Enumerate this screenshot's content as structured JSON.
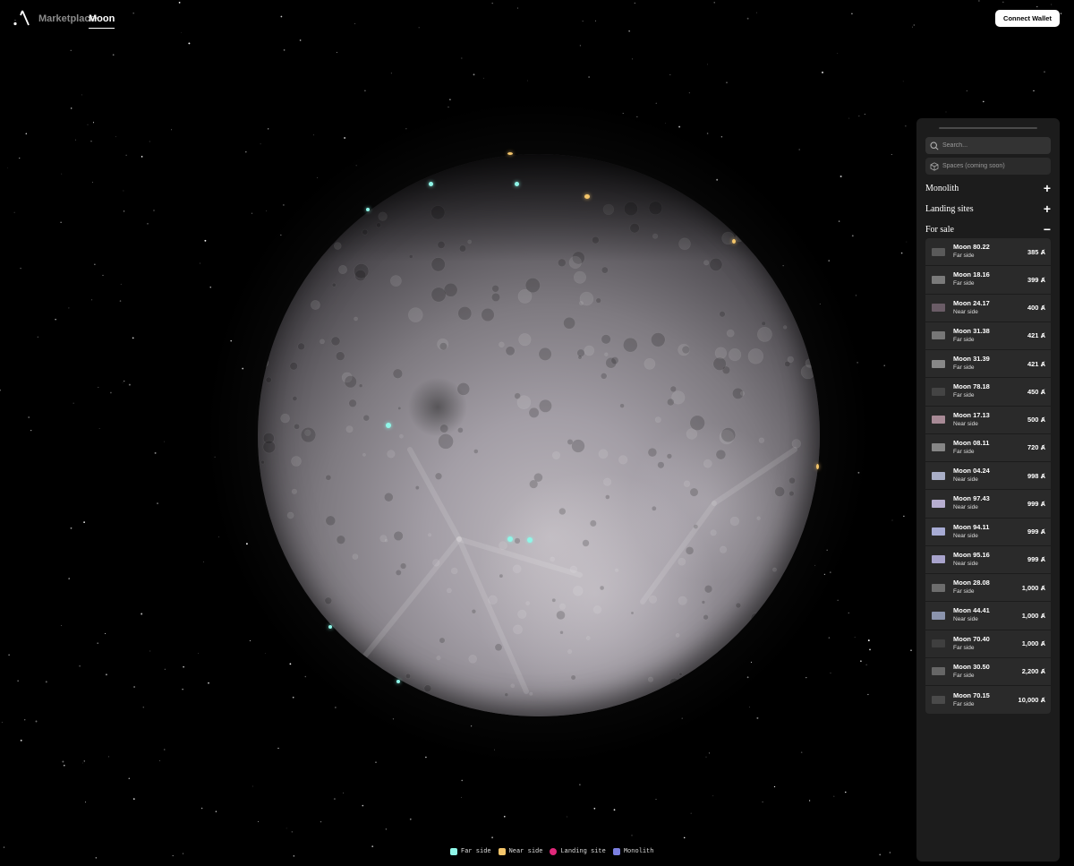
{
  "nav": {
    "links": [
      "Marketplace",
      "Moon"
    ],
    "active": "Moon",
    "connect_label": "Connect Wallet"
  },
  "sidebar": {
    "search_placeholder": "Search...",
    "spaces_label": "Spaces (coming soon)",
    "sections": [
      {
        "label": "Monolith",
        "toggle": "+"
      },
      {
        "label": "Landing sites",
        "toggle": "+"
      },
      {
        "label": "For sale",
        "toggle": "−"
      }
    ],
    "currency_symbol": "Ⱥ",
    "for_sale": [
      {
        "name": "Moon 80.22",
        "side": "Far side",
        "price": "385"
      },
      {
        "name": "Moon 18.16",
        "side": "Far side",
        "price": "399"
      },
      {
        "name": "Moon 24.17",
        "side": "Near side",
        "price": "400"
      },
      {
        "name": "Moon 31.38",
        "side": "Far side",
        "price": "421"
      },
      {
        "name": "Moon 31.39",
        "side": "Far side",
        "price": "421"
      },
      {
        "name": "Moon 78.18",
        "side": "Far side",
        "price": "450"
      },
      {
        "name": "Moon 17.13",
        "side": "Near side",
        "price": "500"
      },
      {
        "name": "Moon 08.11",
        "side": "Far side",
        "price": "720"
      },
      {
        "name": "Moon 04.24",
        "side": "Near side",
        "price": "998"
      },
      {
        "name": "Moon 97.43",
        "side": "Near side",
        "price": "999"
      },
      {
        "name": "Moon 94.11",
        "side": "Near side",
        "price": "999"
      },
      {
        "name": "Moon 95.16",
        "side": "Near side",
        "price": "999"
      },
      {
        "name": "Moon 28.08",
        "side": "Far side",
        "price": "1,000"
      },
      {
        "name": "Moon 44.41",
        "side": "Near side",
        "price": "1,000"
      },
      {
        "name": "Moon 70.40",
        "side": "Far side",
        "price": "1,000"
      },
      {
        "name": "Moon 30.50",
        "side": "Far side",
        "price": "2,200"
      },
      {
        "name": "Moon 70.15",
        "side": "Far side",
        "price": "10,000"
      }
    ]
  },
  "legend": [
    {
      "label": "Far side",
      "color": "#8ff6e8"
    },
    {
      "label": "Near side",
      "color": "#f4c56a"
    },
    {
      "label": "Landing site",
      "color": "#e0287a"
    },
    {
      "label": "Monolith",
      "color": "#7b7fe0"
    }
  ],
  "colors": {
    "background": "#000000",
    "panel": "#1c1c1c",
    "far_side": "#8ff6e8",
    "near_side": "#f4c56a"
  },
  "icons": [
    "logo-icon",
    "search-icon",
    "cube-icon",
    "plus-icon",
    "minus-icon"
  ]
}
